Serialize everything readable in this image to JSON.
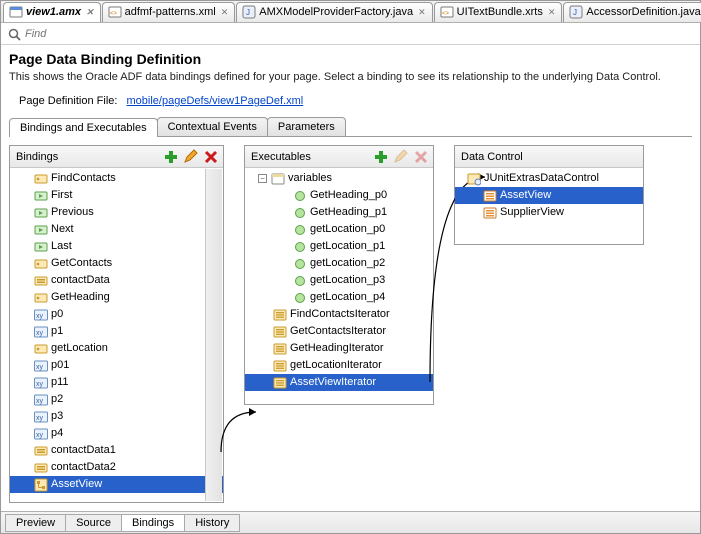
{
  "editorTabs": [
    {
      "label": "view1.amx",
      "icon": "amx",
      "active": true
    },
    {
      "label": "adfmf-patterns.xml",
      "icon": "xml"
    },
    {
      "label": "AMXModelProviderFactory.java",
      "icon": "java"
    },
    {
      "label": "UITextBundle.xrts",
      "icon": "xml"
    },
    {
      "label": "AccessorDefinition.java",
      "icon": "java"
    }
  ],
  "find": {
    "placeholder": "Find"
  },
  "page": {
    "title": "Page Data Binding Definition",
    "desc": "This shows the Oracle ADF data bindings defined for your page. Select a binding to see its relationship to the underlying Data Control.",
    "defLabel": "Page Definition File:",
    "defLink": "mobile/pageDefs/view1PageDef.xml"
  },
  "innerTabs": [
    {
      "label": "Bindings and Executables",
      "active": true
    },
    {
      "label": "Contextual Events"
    },
    {
      "label": "Parameters"
    }
  ],
  "bindings": {
    "title": "Bindings",
    "items": [
      {
        "label": "FindContacts",
        "icon": "method"
      },
      {
        "label": "First",
        "icon": "op"
      },
      {
        "label": "Previous",
        "icon": "op"
      },
      {
        "label": "Next",
        "icon": "op"
      },
      {
        "label": "Last",
        "icon": "op"
      },
      {
        "label": "GetContacts",
        "icon": "method"
      },
      {
        "label": "contactData",
        "icon": "attr"
      },
      {
        "label": "GetHeading",
        "icon": "method"
      },
      {
        "label": "p0",
        "icon": "xy"
      },
      {
        "label": "p1",
        "icon": "xy"
      },
      {
        "label": "getLocation",
        "icon": "method"
      },
      {
        "label": "p01",
        "icon": "xy"
      },
      {
        "label": "p11",
        "icon": "xy"
      },
      {
        "label": "p2",
        "icon": "xy"
      },
      {
        "label": "p3",
        "icon": "xy"
      },
      {
        "label": "p4",
        "icon": "xy"
      },
      {
        "label": "contactData1",
        "icon": "attr"
      },
      {
        "label": "contactData2",
        "icon": "attr"
      },
      {
        "label": "AssetView",
        "icon": "tree",
        "selected": true
      }
    ]
  },
  "executables": {
    "title": "Executables",
    "root": {
      "label": "variables",
      "icon": "vars",
      "expanded": true
    },
    "vars": [
      "GetHeading_p0",
      "GetHeading_p1",
      "getLocation_p0",
      "getLocation_p1",
      "getLocation_p2",
      "getLocation_p3",
      "getLocation_p4"
    ],
    "iters": [
      {
        "label": "FindContactsIterator"
      },
      {
        "label": "GetContactsIterator"
      },
      {
        "label": "GetHeadingIterator"
      },
      {
        "label": "getLocationIterator"
      },
      {
        "label": "AssetViewIterator",
        "selected": true
      }
    ]
  },
  "datacontrol": {
    "title": "Data Control",
    "root": "JUnitExtrasDataControl",
    "items": [
      {
        "label": "AssetView",
        "selected": true
      },
      {
        "label": "SupplierView"
      }
    ]
  },
  "bottomTabs": [
    {
      "label": "Preview"
    },
    {
      "label": "Source"
    },
    {
      "label": "Bindings",
      "active": true
    },
    {
      "label": "History"
    }
  ]
}
